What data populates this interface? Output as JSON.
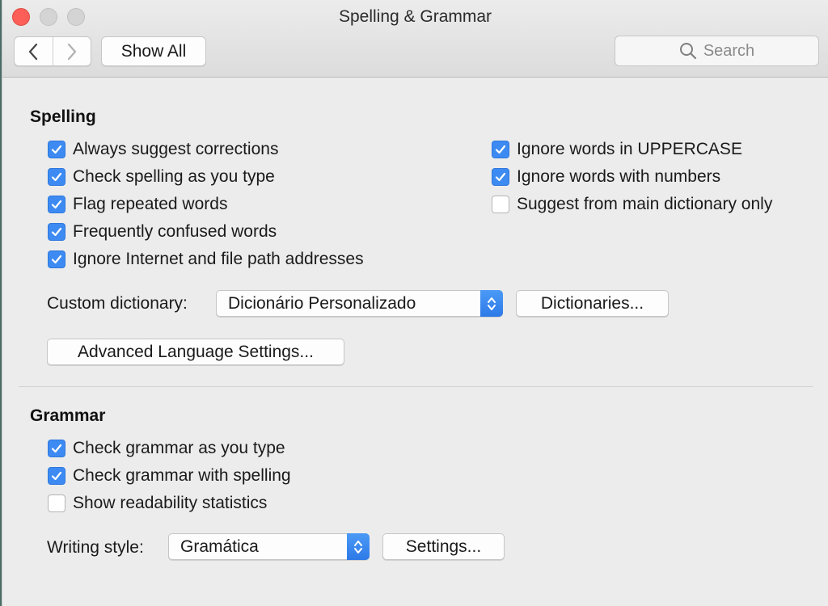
{
  "window": {
    "title": "Spelling & Grammar"
  },
  "toolbar": {
    "show_all": "Show All",
    "search_placeholder": "Search"
  },
  "spelling": {
    "title": "Spelling",
    "left_options": [
      {
        "label": "Always suggest corrections",
        "checked": true
      },
      {
        "label": "Check spelling as you type",
        "checked": true
      },
      {
        "label": "Flag repeated words",
        "checked": true
      },
      {
        "label": "Frequently confused words",
        "checked": true
      },
      {
        "label": "Ignore Internet and file path addresses",
        "checked": true
      }
    ],
    "right_options": [
      {
        "label": "Ignore words in UPPERCASE",
        "checked": true
      },
      {
        "label": "Ignore words with numbers",
        "checked": true
      },
      {
        "label": "Suggest from main dictionary only",
        "checked": false
      }
    ],
    "custom_dictionary_label": "Custom dictionary:",
    "custom_dictionary_value": "Dicionário Personalizado",
    "dictionaries_button": "Dictionaries...",
    "advanced_button": "Advanced Language Settings..."
  },
  "grammar": {
    "title": "Grammar",
    "options": [
      {
        "label": "Check grammar as you type",
        "checked": true
      },
      {
        "label": "Check grammar with spelling",
        "checked": true
      },
      {
        "label": "Show readability statistics",
        "checked": false
      }
    ],
    "writing_style_label": "Writing style:",
    "writing_style_value": "Gramática",
    "settings_button": "Settings..."
  },
  "colors": {
    "accent": "#3d8bf2",
    "close": "#fc5f57"
  }
}
